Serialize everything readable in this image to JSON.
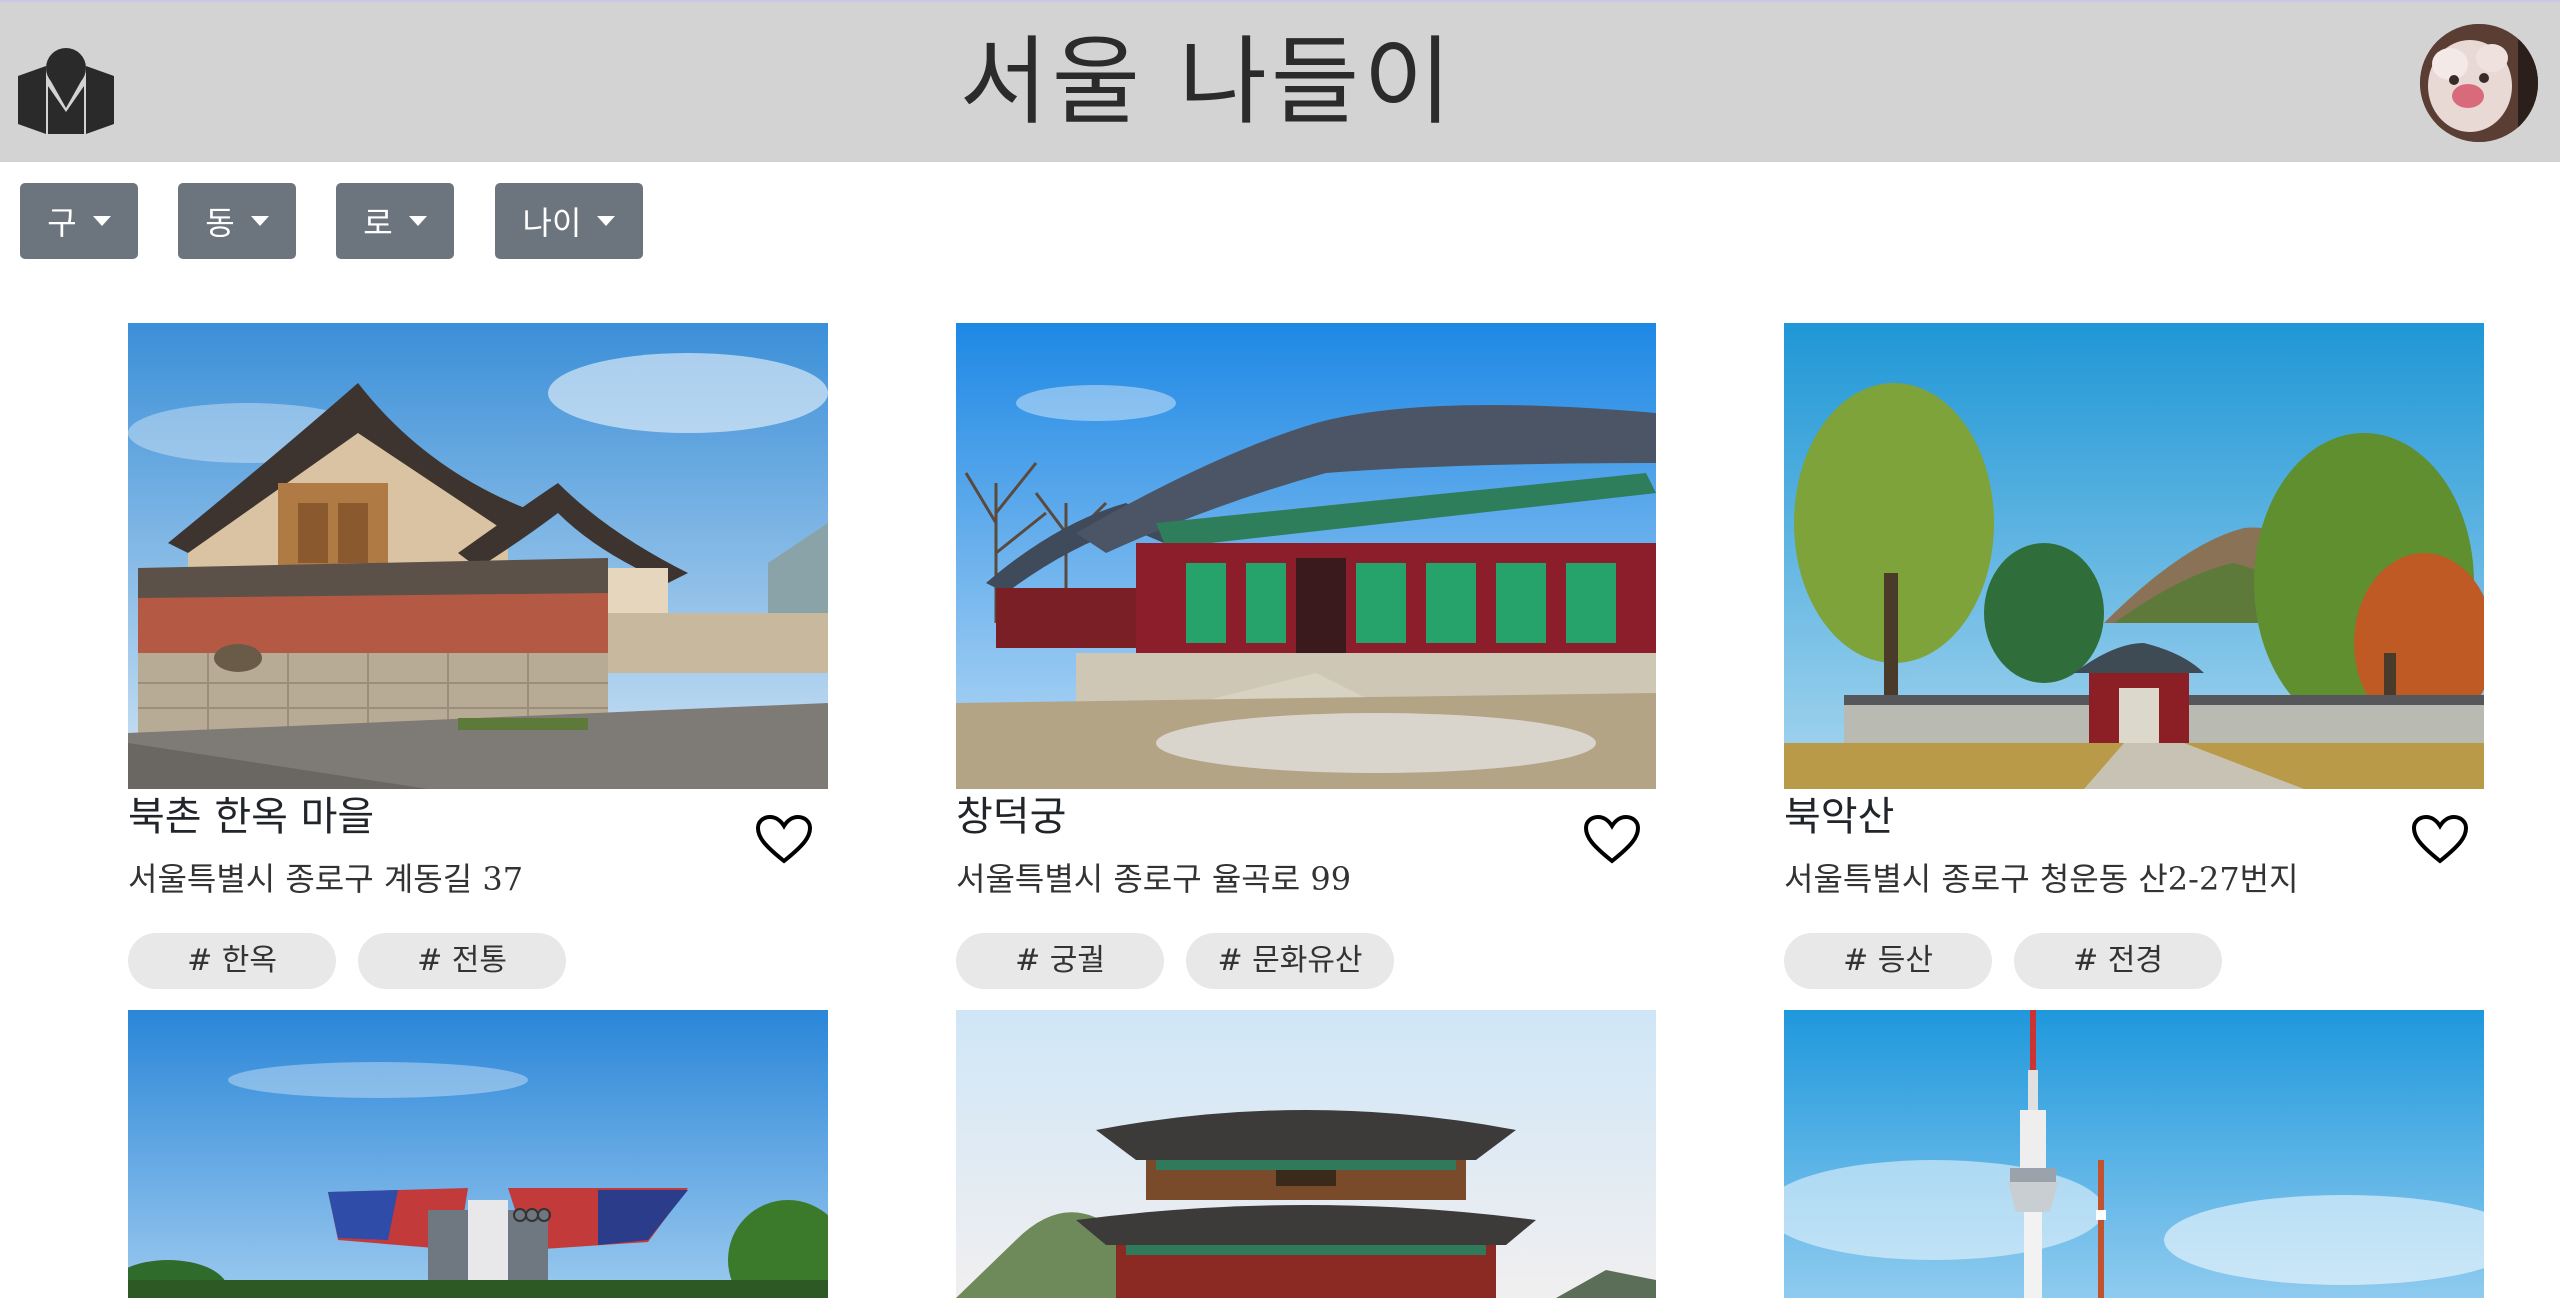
{
  "header": {
    "title": "서울 나들이",
    "logo_icon": "map-pin-logo-icon",
    "avatar_icon": "user-avatar",
    "background": "#d3d3d3"
  },
  "filters": [
    {
      "label": "구"
    },
    {
      "label": "동"
    },
    {
      "label": "로"
    },
    {
      "label": "나이"
    }
  ],
  "places": [
    {
      "name": "북촌 한옥 마을",
      "address": "서울특별시 종로구 계동길 37",
      "tags": [
        "# 한옥",
        "# 전통"
      ],
      "image": "hanok-village-photo"
    },
    {
      "name": "창덕궁",
      "address": "서울특별시 종로구 율곡로 99",
      "tags": [
        "# 궁궐",
        "# 문화유산"
      ],
      "image": "changdeokgung-palace-photo"
    },
    {
      "name": "북악산",
      "address": "서울특별시 종로구 청운동 산2-27번지",
      "tags": [
        "# 등산",
        "# 전경"
      ],
      "image": "bukaksan-mountain-photo"
    },
    {
      "name": "",
      "address": "",
      "tags": [],
      "image": "olympic-peace-gate-photo"
    },
    {
      "name": "",
      "address": "",
      "tags": [],
      "image": "gyeongbokgung-gate-photo"
    },
    {
      "name": "",
      "address": "",
      "tags": [],
      "image": "n-seoul-tower-photo"
    }
  ],
  "colors": {
    "filter_button": "#6c757d",
    "tag_background": "#e8e8e8"
  }
}
